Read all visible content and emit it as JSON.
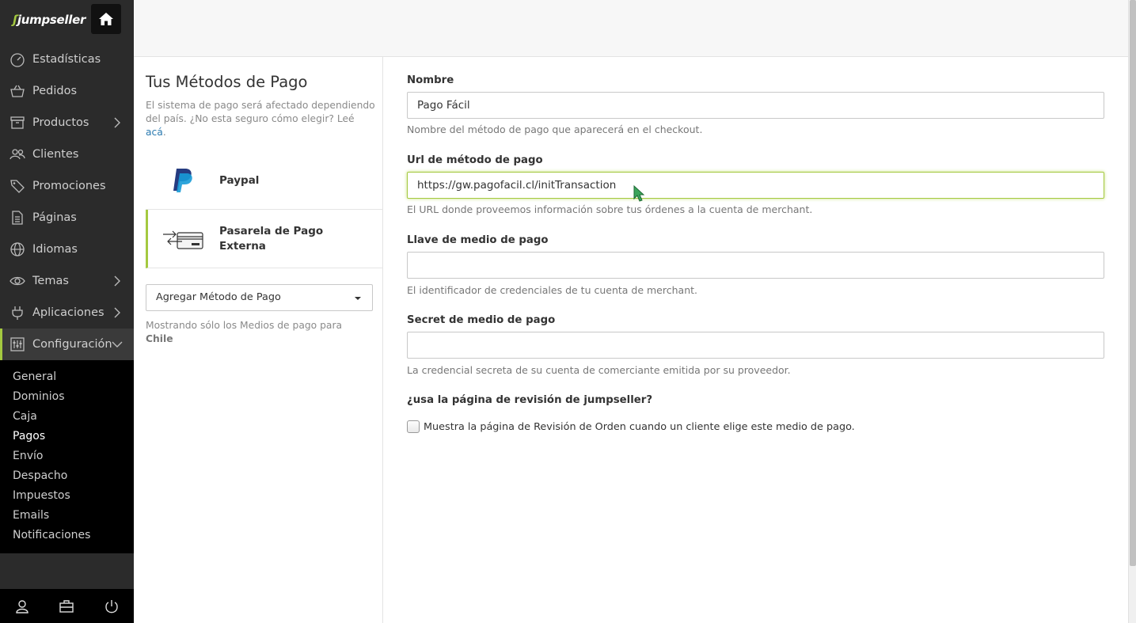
{
  "brand": {
    "logo_text": "jumpseller",
    "accent": "#a4c940"
  },
  "sidebar": {
    "home_icon": "home-icon",
    "items": [
      {
        "label": "Estadísticas",
        "icon": "gauge-icon",
        "has_submenu": false
      },
      {
        "label": "Pedidos",
        "icon": "basket-icon",
        "has_submenu": false
      },
      {
        "label": "Productos",
        "icon": "box-icon",
        "has_submenu": true
      },
      {
        "label": "Clientes",
        "icon": "users-icon",
        "has_submenu": false
      },
      {
        "label": "Promociones",
        "icon": "tag-icon",
        "has_submenu": false
      },
      {
        "label": "Páginas",
        "icon": "document-icon",
        "has_submenu": false
      },
      {
        "label": "Idiomas",
        "icon": "globe-icon",
        "has_submenu": false
      },
      {
        "label": "Temas",
        "icon": "eye-icon",
        "has_submenu": true
      },
      {
        "label": "Aplicaciones",
        "icon": "plug-icon",
        "has_submenu": true
      },
      {
        "label": "Configuración",
        "icon": "settings-icon",
        "has_submenu": true,
        "expanded": true
      }
    ],
    "submenu": [
      "General",
      "Dominios",
      "Caja",
      "Pagos",
      "Envío",
      "Despacho",
      "Impuestos",
      "Emails",
      "Notificaciones"
    ],
    "submenu_current": "Pagos",
    "bottom_icons": [
      "user-icon",
      "briefcase-icon",
      "power-icon"
    ]
  },
  "left_panel": {
    "title": "Tus Métodos de Pago",
    "description": "El sistema de pago será afectado dependiendo del país. ¿No esta seguro cómo elegir? Leé",
    "description_link": "acá",
    "description_end": ".",
    "methods": [
      {
        "name": "Paypal",
        "icon": "paypal-icon"
      },
      {
        "name": "Pasarela de Pago Externa",
        "icon": "external-gateway-icon",
        "active": true
      }
    ],
    "add_select_value": "Agregar Método de Pago",
    "note_prefix": "Mostrando sólo los Medios de pago para",
    "note_country": "Chile"
  },
  "form": {
    "name_label": "Nombre",
    "name_value": "Pago Fácil",
    "name_help": "Nombre del método de pago que aparecerá en el checkout.",
    "url_label": "Url de método de pago",
    "url_value": "https://gw.pagofacil.cl/initTransaction",
    "url_help": "El URL donde proveemos información sobre tus órdenes a la cuenta de merchant.",
    "key_label": "Llave de medio de pago",
    "key_value": "",
    "key_help": "El identificador de credenciales de tu cuenta de merchant.",
    "secret_label": "Secret de medio de pago",
    "secret_value": "",
    "secret_help": "La credencial secreta de su cuenta de comerciante emitida por su proveedor.",
    "review_label": "¿usa la página de revisión de jumpseller?",
    "review_checkbox_label": "Muestra la página de Revisión de Orden cuando un cliente elige este medio de pago.",
    "review_checked": false
  }
}
